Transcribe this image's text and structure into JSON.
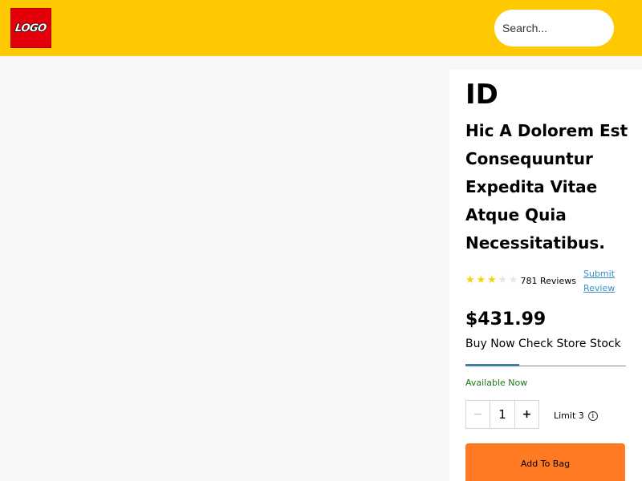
{
  "header": {
    "logo_text": "LOGO",
    "search_placeholder": "Search...",
    "background_color": "#ffc901"
  },
  "product": {
    "id": "ID",
    "title": "Hic A Dolorem Est Consequuntur Expedita Vitae Atque Quia Necessitatibus.",
    "rating": {
      "stars_filled": 3,
      "stars_total": 5,
      "star_color": "#f5d400"
    },
    "reviews_label": "781 Reviews",
    "submit_review_label": "Submit Review",
    "price": "$431.99",
    "tabs": [
      {
        "label": "Buy Now",
        "active": true
      },
      {
        "label": "Check Store Stock",
        "active": false
      }
    ],
    "availability": "Available Now",
    "availability_color": "#1a7a1a",
    "quantity": {
      "decrement_icon": "minus-icon",
      "value": "1",
      "increment_icon": "plus-icon"
    },
    "limit_label": "Limit 3",
    "limit_icon": "info-icon",
    "add_to_bag_label": "Add To Bag",
    "add_to_bag_color": "#ff7a22"
  }
}
